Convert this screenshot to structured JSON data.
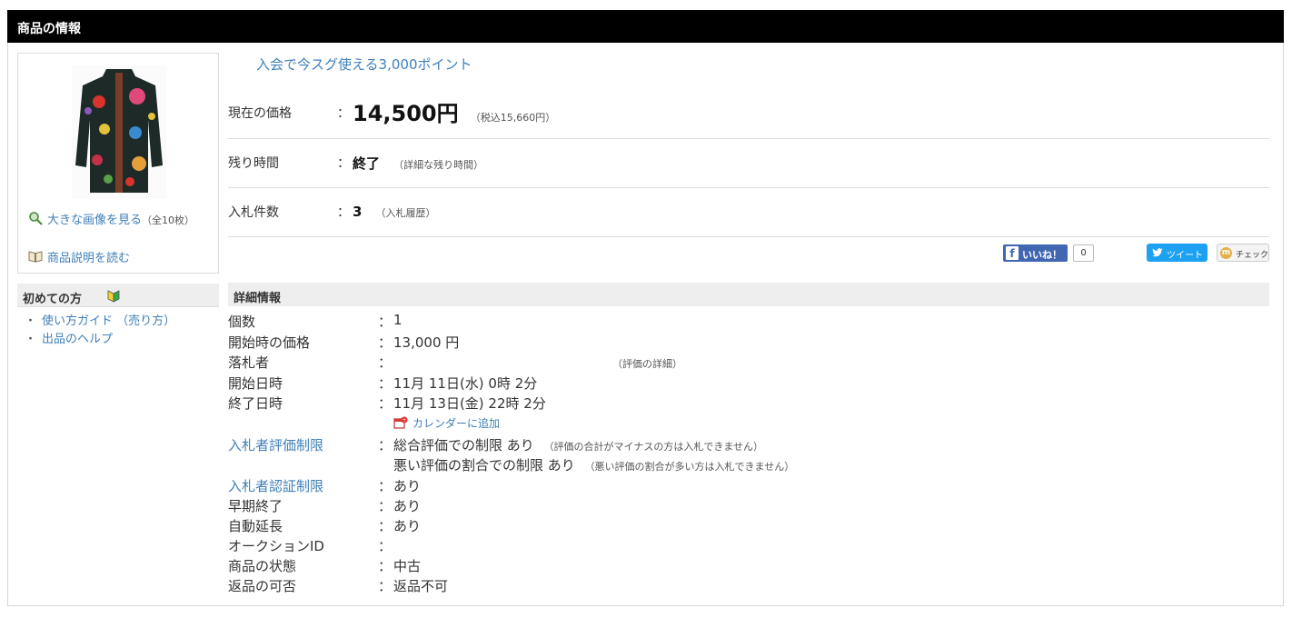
{
  "header": {
    "title": "商品の情報"
  },
  "gallery": {
    "zoom_link": "大きな画像を見る",
    "zoom_note": "（全10枚）",
    "read_link": "商品説明を読む"
  },
  "beginner": {
    "title": "初めての方",
    "links": [
      "使い方ガイド （売り方）",
      "出品のヘルプ"
    ]
  },
  "promo": "入会で今スグ使える3,000ポイント",
  "price": {
    "label": "現在の価格",
    "value": "14,500円",
    "tax_note": "（税込15,660円）"
  },
  "time_left": {
    "label": "残り時間",
    "value": "終了",
    "detail_link": "（詳細な残り時間）"
  },
  "bids": {
    "label": "入札件数",
    "value": "3",
    "history_link": "（入札履歴）"
  },
  "social": {
    "like_label": "いいね！",
    "like_count": "0",
    "tweet_label": "ツイート",
    "check_label": "チェック"
  },
  "colon": "：",
  "details": {
    "title": "詳細情報",
    "quantity": {
      "label": "個数",
      "value": "1"
    },
    "start_price": {
      "label": "開始時の価格",
      "value": "13,000 円"
    },
    "winner": {
      "label": "落札者",
      "rating_link": "（評価の詳細）"
    },
    "start_date": {
      "label": "開始日時",
      "value": "11月 11日(水) 0時 2分"
    },
    "end_date": {
      "label": "終了日時",
      "value": "11月 13日(金) 22時 2分"
    },
    "calendar_link": "カレンダーに追加",
    "rating_limit": {
      "label": "入札者評価制限",
      "value1": "総合評価での制限 あり",
      "note1": "（評価の合計がマイナスの方は入札できません）",
      "value2": "悪い評価の割合での制限 あり",
      "note2": "（悪い評価の割合が多い方は入札できません）"
    },
    "auth_limit": {
      "label": "入札者認証制限",
      "value": "あり"
    },
    "early_end": {
      "label": "早期終了",
      "value": "あり"
    },
    "auto_extend": {
      "label": "自動延長",
      "value": "あり"
    },
    "auction_id": {
      "label": "オークションID",
      "value": ""
    },
    "condition": {
      "label": "商品の状態",
      "value": "中古"
    },
    "returns": {
      "label": "返品の可否",
      "value": "返品不可"
    }
  },
  "colors": {
    "link": "#3f7fb8",
    "header_bg": "#000000",
    "section_bg": "#eeeeee",
    "facebook": "#4267b2",
    "twitter": "#1da1f2"
  }
}
